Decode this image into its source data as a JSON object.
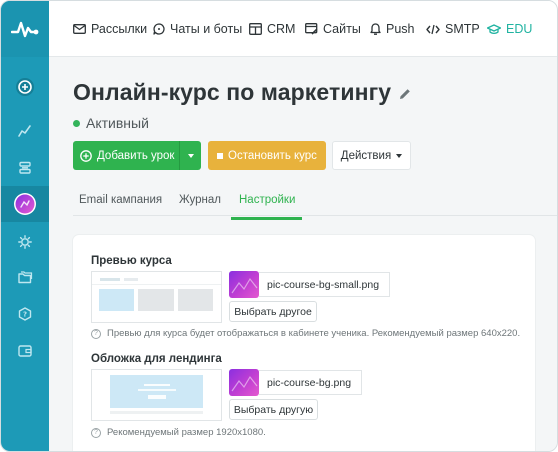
{
  "nav": {
    "items": [
      {
        "label": "Рассылки",
        "icon": "envelope-icon"
      },
      {
        "label": "Чаты и боты",
        "icon": "chat-bubble-icon"
      },
      {
        "label": "CRM",
        "icon": "crm-icon"
      },
      {
        "label": "Сайты",
        "icon": "site-edit-icon"
      },
      {
        "label": "Push",
        "icon": "bell-icon"
      },
      {
        "label": "SMTP",
        "icon": "code-icon"
      },
      {
        "label": "EDU",
        "icon": "graduation-cap-icon"
      }
    ],
    "active": "EDU"
  },
  "sidebar": {
    "logo": "pulse-logo-icon",
    "items": [
      "plus-circle-icon",
      "chart-line-icon",
      "layers-icon",
      "course-avatar-icon",
      "gear-icon",
      "folders-icon",
      "help-icon",
      "wallet-icon"
    ],
    "active_index": 3
  },
  "page": {
    "title": "Онлайн-курс по маркетингу",
    "status": "Активный",
    "status_color": "#33b35a"
  },
  "buttons": {
    "add_lesson": "Добавить урок",
    "stop_course": "Остановить курс",
    "actions": "Действия"
  },
  "tabs": {
    "items": [
      "Email кампания",
      "Журнал",
      "Настройки"
    ],
    "active": "Настройки"
  },
  "preview": {
    "title": "Превью курса",
    "file_name": "pic-course-bg-small.png",
    "button": "Выбрать другое",
    "hint": "Превью для курса будет отображаться в кабинете ученика. Рекомендуемый размер 640х220."
  },
  "cover": {
    "title": "Обложка для лендинга",
    "file_name": "pic-course-bg.png",
    "button": "Выбрать другую",
    "hint": "Рекомендуемый размер 1920х1080."
  },
  "colors": {
    "sidebar": "#1d9ab7",
    "accent_green": "#2fb34f",
    "accent_orange": "#e8b23c",
    "nav_active": "#20b3a1"
  }
}
